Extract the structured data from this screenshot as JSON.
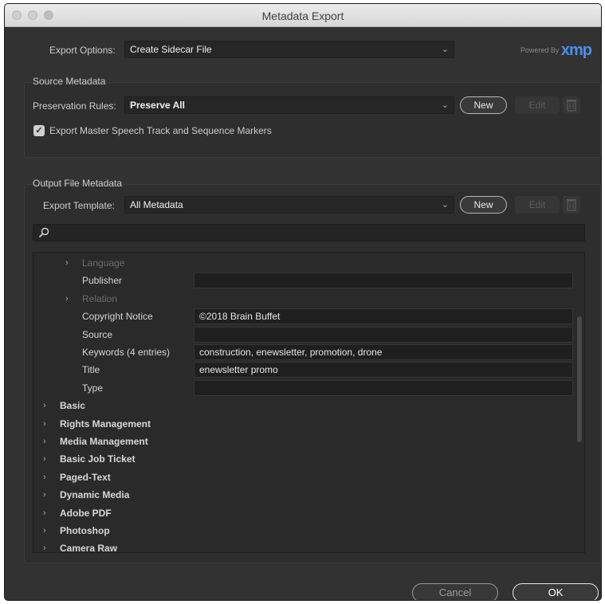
{
  "window": {
    "title": "Metadata Export"
  },
  "export_options": {
    "label": "Export Options:",
    "value": "Create Sidecar File"
  },
  "powered_by": {
    "text": "Powered By",
    "logo": "xmp"
  },
  "source_metadata": {
    "title": "Source Metadata",
    "preservation_label": "Preservation Rules:",
    "preservation_value": "Preserve All",
    "new_label": "New",
    "edit_label": "Edit",
    "checkbox_label": "Export Master Speech Track and Sequence Markers",
    "checkbox_checked": true
  },
  "output_metadata": {
    "title": "Output File Metadata",
    "template_label": "Export Template:",
    "template_value": "All Metadata",
    "new_label": "New",
    "edit_label": "Edit",
    "search_placeholder": ""
  },
  "tree": {
    "sub_items": [
      {
        "name": "Language",
        "expandable": true,
        "dim": true,
        "value": null
      },
      {
        "name": "Publisher",
        "expandable": false,
        "dim": false,
        "value": ""
      },
      {
        "name": "Relation",
        "expandable": true,
        "dim": true,
        "value": null
      },
      {
        "name": "Copyright Notice",
        "expandable": false,
        "dim": false,
        "value": "©2018 Brain Buffet"
      },
      {
        "name": "Source",
        "expandable": false,
        "dim": false,
        "value": ""
      },
      {
        "name": "Keywords (4 entries)",
        "expandable": false,
        "dim": false,
        "value": "construction, enewsletter, promotion, drone"
      },
      {
        "name": "Title",
        "expandable": false,
        "dim": false,
        "value": "enewsletter promo"
      },
      {
        "name": "Type",
        "expandable": false,
        "dim": false,
        "value": ""
      }
    ],
    "groups": [
      "Basic",
      "Rights Management",
      "Media Management",
      "Basic Job Ticket",
      "Paged-Text",
      "Dynamic Media",
      "Adobe PDF",
      "Photoshop",
      "Camera Raw"
    ]
  },
  "footer": {
    "cancel_label": "Cancel",
    "ok_label": "OK"
  },
  "colors": {
    "background": "#323232",
    "field": "#1f1f1f",
    "xmp_blue": "#4a8ff0"
  }
}
